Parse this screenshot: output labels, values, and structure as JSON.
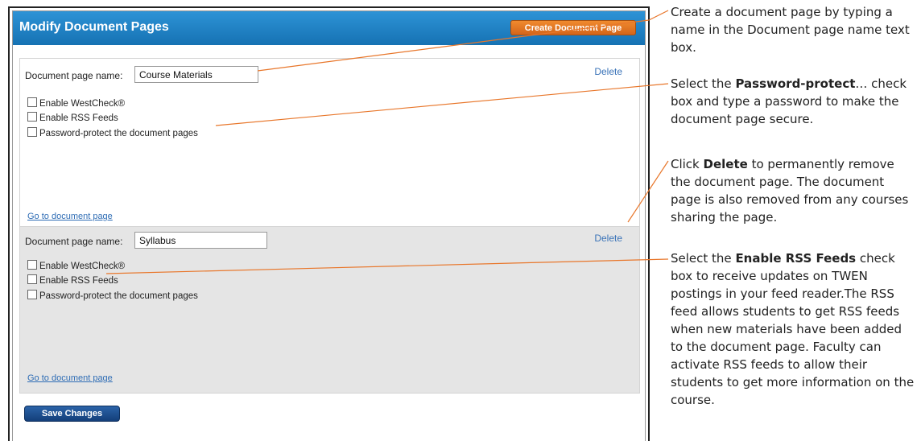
{
  "window": {
    "title": "Modify Document Pages",
    "create_button": "Create Document Page",
    "save_button": "Save Changes"
  },
  "pages": [
    {
      "name_label": "Document page name:",
      "name_value": "Course Materials",
      "delete_label": "Delete",
      "checkboxes": [
        "Enable WestCheck®",
        "Enable RSS Feeds",
        "Password-protect the document pages"
      ],
      "goto_link": "Go to document page"
    },
    {
      "name_label": "Document page name:",
      "name_value": "Syllabus",
      "delete_label": "Delete",
      "checkboxes": [
        "Enable WestCheck®",
        "Enable RSS Feeds",
        "Password-protect the document pages"
      ],
      "goto_link": "Go to document page"
    }
  ],
  "callouts": {
    "create": "Create a document page by typing a name in the Document page name text box.",
    "password_pre": "Select the ",
    "password_bold": "Password-protect",
    "password_post": "… check box and type a password to make the document page secure.",
    "delete_pre": "Click ",
    "delete_bold": "Delete",
    "delete_post": " to permanently remove the document page. The document page is also removed from any courses sharing the page.",
    "rss_pre": "Select the ",
    "rss_bold": "Enable RSS Feeds",
    "rss_post": " check box to receive updates on TWEN postings in your feed reader.The RSS feed allows students to get RSS feeds when new materials have been added to the document page. Faculty can activate RSS feeds to allow their students to get more information on the course."
  },
  "colors": {
    "header": "#1a7fc1",
    "create_button": "#e4782a",
    "save_button": "#1c4f8f",
    "leader_line": "#e8762a"
  }
}
